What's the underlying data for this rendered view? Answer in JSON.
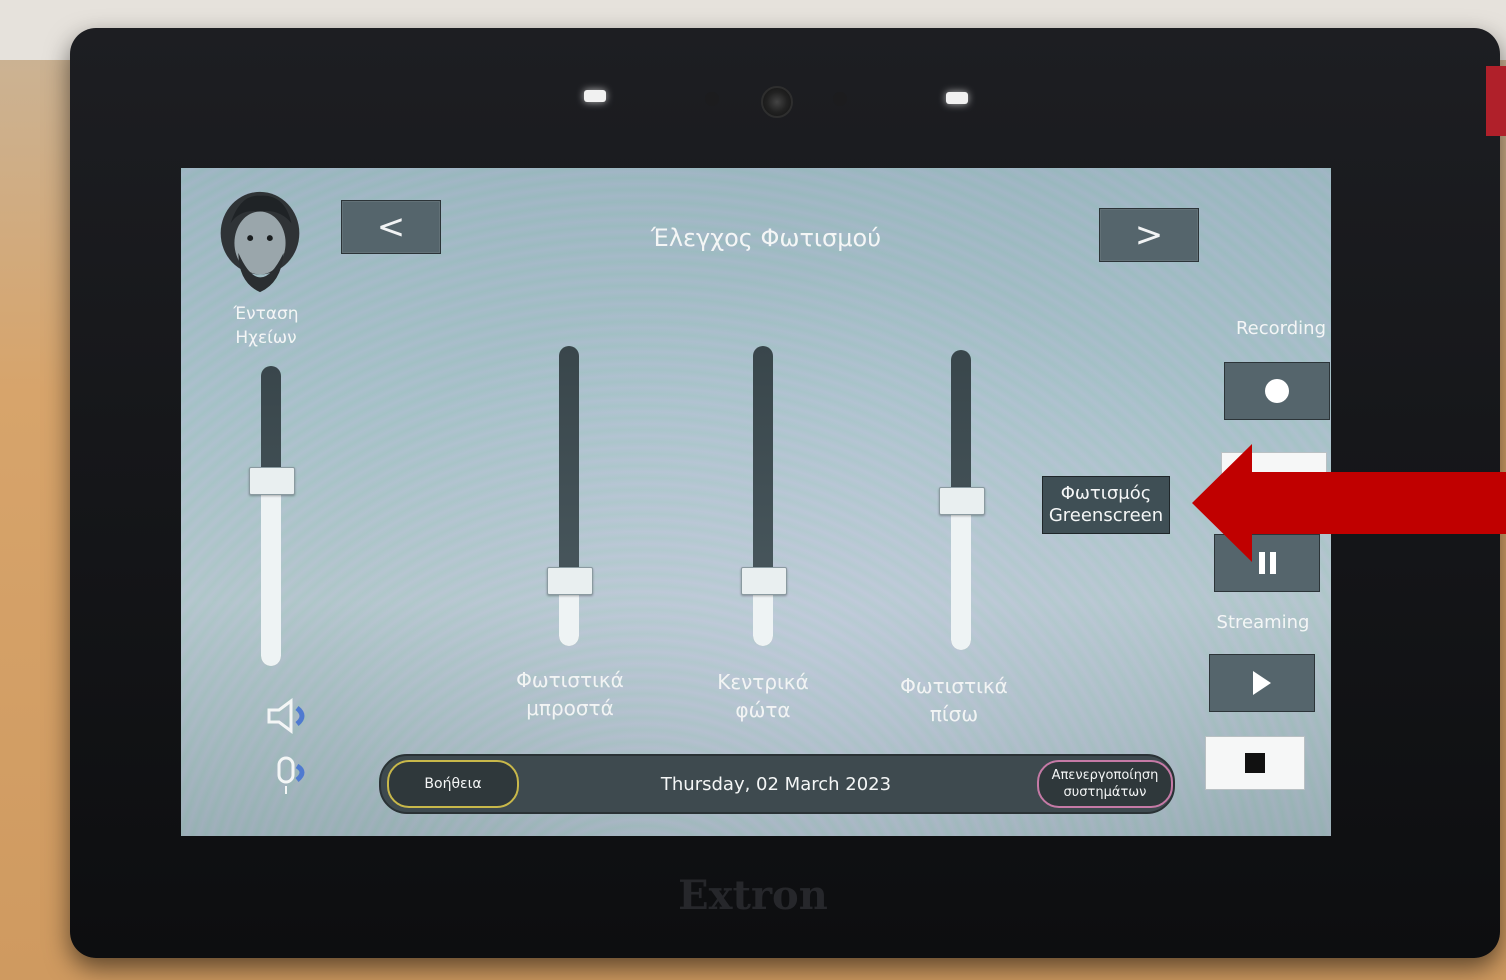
{
  "header": {
    "title": "Έλεγχος Φωτισμού"
  },
  "nav": {
    "prev_label": "<",
    "next_label": ">"
  },
  "volume": {
    "label_line1": "Ένταση",
    "label_line2": "Ηχείων",
    "level": 0.62,
    "icons": [
      "speaker-icon",
      "microphone-icon"
    ]
  },
  "sliders": [
    {
      "label_line1": "Φωτιστικά",
      "label_line2": "μπροστά",
      "level": 0.22
    },
    {
      "label_line1": "Κεντρικά",
      "label_line2": "φώτα",
      "level": 0.22
    },
    {
      "label_line1": "Φωτιστικά",
      "label_line2": "πίσω",
      "level": 0.5
    }
  ],
  "greenscreen": {
    "line1": "Φωτισμός",
    "line2": "Greenscreen"
  },
  "recording": {
    "label": "Recording",
    "icons": [
      "record-icon",
      "pause-icon"
    ]
  },
  "streaming": {
    "label": "Streaming",
    "icons": [
      "play-icon",
      "stop-icon"
    ]
  },
  "footer": {
    "help_label": "Βοήθεια",
    "date": "Thursday, 02 March 2023",
    "shutdown_line1": "Απενεργοποίηση",
    "shutdown_line2": "συστημάτων"
  },
  "device": {
    "brand": "Extron"
  },
  "colors": {
    "annotation_arrow": "#c00000",
    "button_bg": "#55656c",
    "help_border": "#c8b84a",
    "shutdown_border": "#c57aa6"
  }
}
